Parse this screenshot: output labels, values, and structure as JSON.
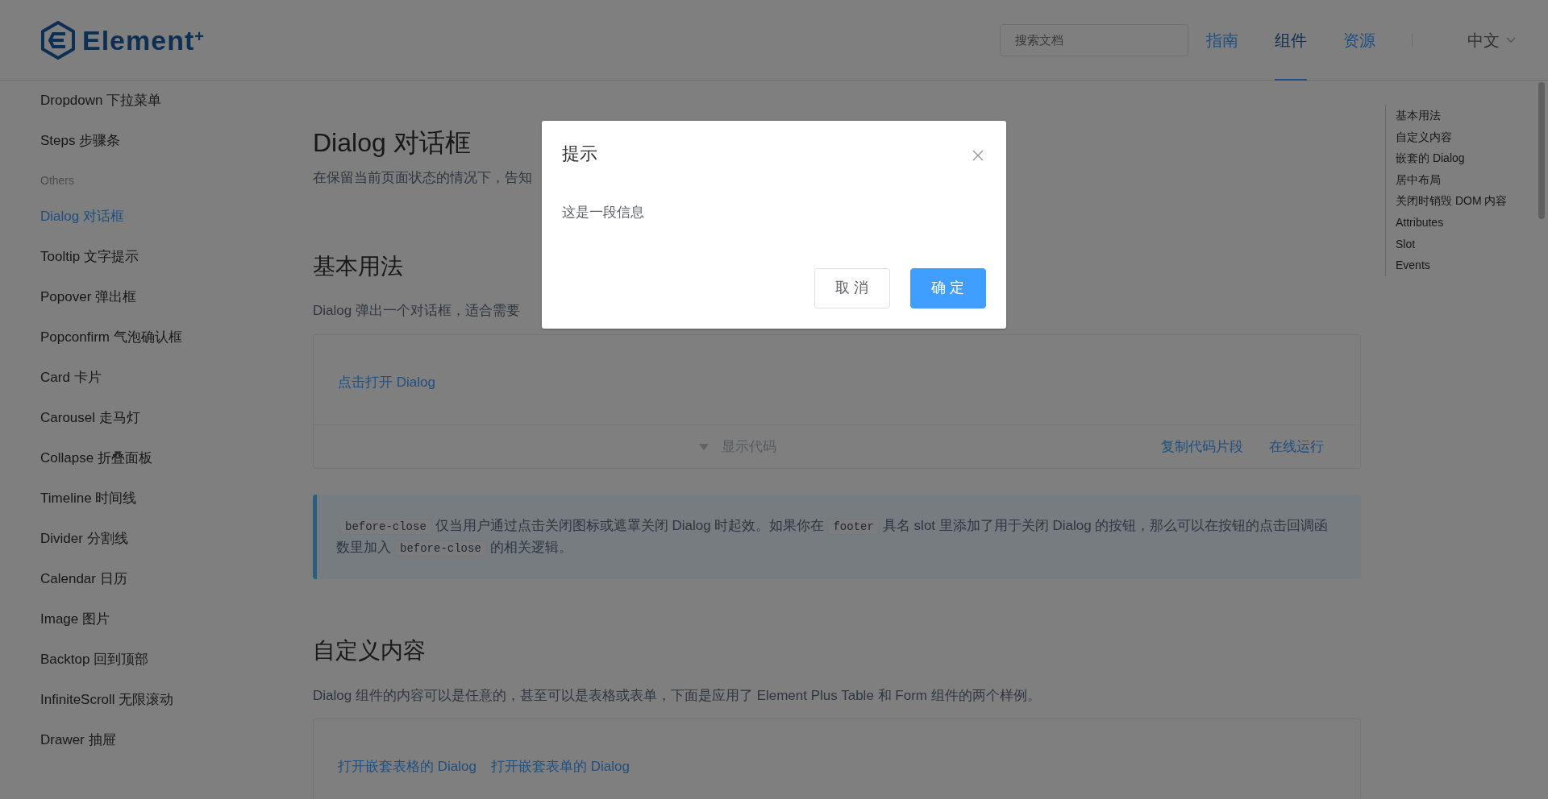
{
  "header": {
    "logo": "Element$^{+}$",
    "search": {
      "placeholder": "搜索文档"
    },
    "nav": [
      {
        "label": "指南",
        "selected": false
      },
      {
        "label": "组件",
        "selected": true
      },
      {
        "label": "资源",
        "selected": false
      }
    ],
    "language": "中文"
  },
  "sidebar": {
    "items": [
      {
        "kind": "link",
        "label": "Dropdown 下拉菜单",
        "selected": false
      },
      {
        "kind": "link",
        "label": "Steps 步骤条",
        "selected": false
      },
      {
        "kind": "group",
        "label": "Others"
      },
      {
        "kind": "link",
        "label": "Dialog 对话框",
        "selected": true
      },
      {
        "kind": "link",
        "label": "Tooltip 文字提示",
        "selected": false
      },
      {
        "kind": "link",
        "label": "Popover 弹出框",
        "selected": false
      },
      {
        "kind": "link",
        "label": "Popconfirm 气泡确认框",
        "selected": false
      },
      {
        "kind": "link",
        "label": "Card 卡片",
        "selected": false
      },
      {
        "kind": "link",
        "label": "Carousel 走马灯",
        "selected": false
      },
      {
        "kind": "link",
        "label": "Collapse 折叠面板",
        "selected": false
      },
      {
        "kind": "link",
        "label": "Timeline 时间线",
        "selected": false
      },
      {
        "kind": "link",
        "label": "Divider 分割线",
        "selected": false
      },
      {
        "kind": "link",
        "label": "Calendar 日历",
        "selected": false
      },
      {
        "kind": "link",
        "label": "Image 图片",
        "selected": false
      },
      {
        "kind": "link",
        "label": "Backtop 回到顶部",
        "selected": false
      },
      {
        "kind": "link",
        "label": "InfiniteScroll 无限滚动",
        "selected": false
      },
      {
        "kind": "link",
        "label": "Drawer 抽屉",
        "selected": false
      }
    ]
  },
  "content": {
    "title": "Dialog 对话框",
    "description": "在保留当前页面状态的情况下，告知",
    "sections": [
      {
        "heading": "基本用法",
        "text": "Dialog 弹出一个对话框，适合需要",
        "demo": {
          "links": [
            "点击打开 Dialog"
          ],
          "toggle": "显示代码",
          "actions": [
            "复制代码片段",
            "在线运行"
          ]
        },
        "tip": [
          {
            "kind": "code",
            "text": "before-close"
          },
          {
            "kind": "text",
            "text": "仅当用户通过点击关闭图标或遮罩关闭 Dialog 时起效。如果你在"
          },
          {
            "kind": "code",
            "text": "footer"
          },
          {
            "kind": "text",
            "text": "具名 slot 里添加了用于关闭 Dialog 的按钮，那么可以在按钮的点击回调函数里加入"
          },
          {
            "kind": "code",
            "text": "before-close"
          },
          {
            "kind": "text",
            "text": "的相关逻辑。"
          }
        ]
      },
      {
        "heading": "自定义内容",
        "text": "Dialog 组件的内容可以是任意的，甚至可以是表格或表单，下面是应用了 Element Plus Table 和 Form 组件的两个样例。",
        "demo": {
          "links": [
            "打开嵌套表格的 Dialog",
            "打开嵌套表单的 Dialog"
          ]
        }
      }
    ]
  },
  "toc": [
    "基本用法",
    "自定义内容",
    "嵌套的 Dialog",
    "居中布局",
    "关闭时销毁 DOM 内容",
    "Attributes",
    "Slot",
    "Events"
  ],
  "dialog": {
    "title": "提示",
    "body": "这是一段信息",
    "buttons": [
      {
        "label": "取 消",
        "kind": "default"
      },
      {
        "label": "确 定",
        "kind": "primary"
      }
    ]
  }
}
